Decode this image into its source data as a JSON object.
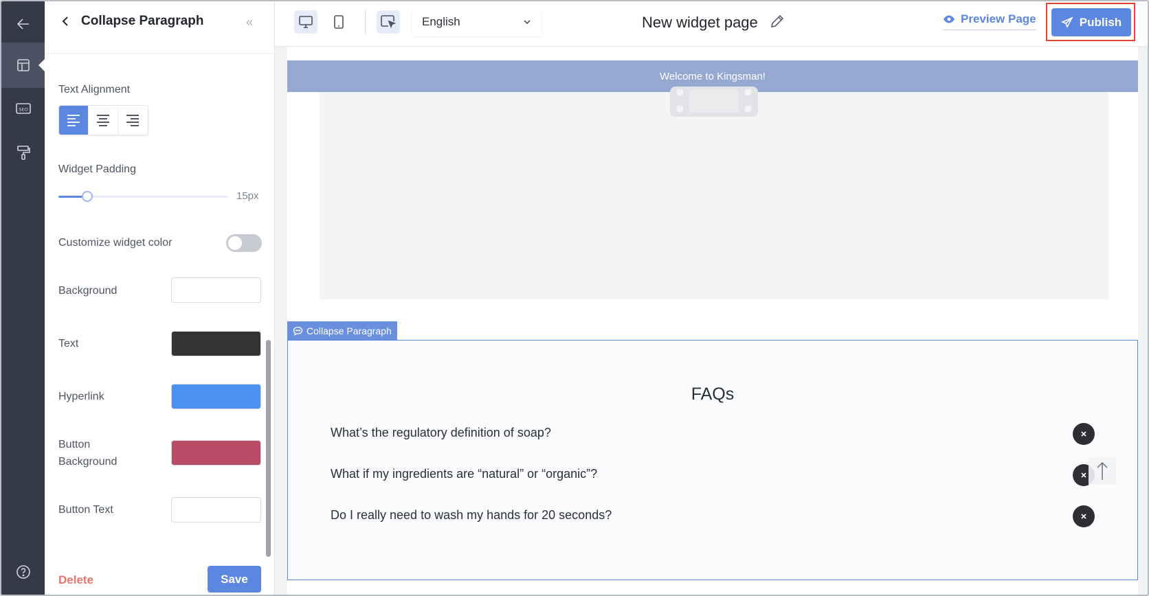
{
  "panel": {
    "title": "Collapse Paragraph",
    "labels": {
      "text_alignment": "Text Alignment",
      "widget_padding": "Widget Padding",
      "customize_color": "Customize widget color",
      "background": "Background",
      "text": "Text",
      "hyperlink": "Hyperlink",
      "button_background_line1": "Button",
      "button_background_line2": "Background",
      "button_text": "Button Text"
    },
    "padding_value": "15px",
    "padding_fraction": 0.17,
    "customize_enabled": false,
    "text_alignment_selected": "left",
    "swatches": {
      "background": "#ffffff",
      "text": "#333333",
      "hyperlink": "#4d90f0",
      "button_background": "#b84c64",
      "button_text": "#ffffff"
    },
    "delete_label": "Delete",
    "save_label": "Save"
  },
  "toolbar": {
    "language": "English",
    "page_title": "New widget page",
    "preview_label": "Preview Page",
    "publish_label": "Publish"
  },
  "canvas": {
    "banner_text": "Welcome to Kingsman!",
    "widget_tag": "Collapse Paragraph",
    "faq_title": "FAQs",
    "faqs": [
      "What’s the regulatory definition of soap?",
      "What if my ingredients are “natural” or “organic”?",
      "Do I really need to wash my hands for 20 seconds?"
    ]
  },
  "colors": {
    "accent": "#5b87e0",
    "rail": "#343a47",
    "highlight": "#e0452f"
  },
  "icons": {
    "rail": [
      "arrow-left-icon",
      "layout-icon",
      "seo-icon",
      "paint-roller-icon",
      "help-icon"
    ],
    "toolbar": [
      "desktop-icon",
      "mobile-icon",
      "cursor-select-icon",
      "chevron-down-icon",
      "pencil-icon",
      "eye-icon",
      "send-icon"
    ]
  }
}
